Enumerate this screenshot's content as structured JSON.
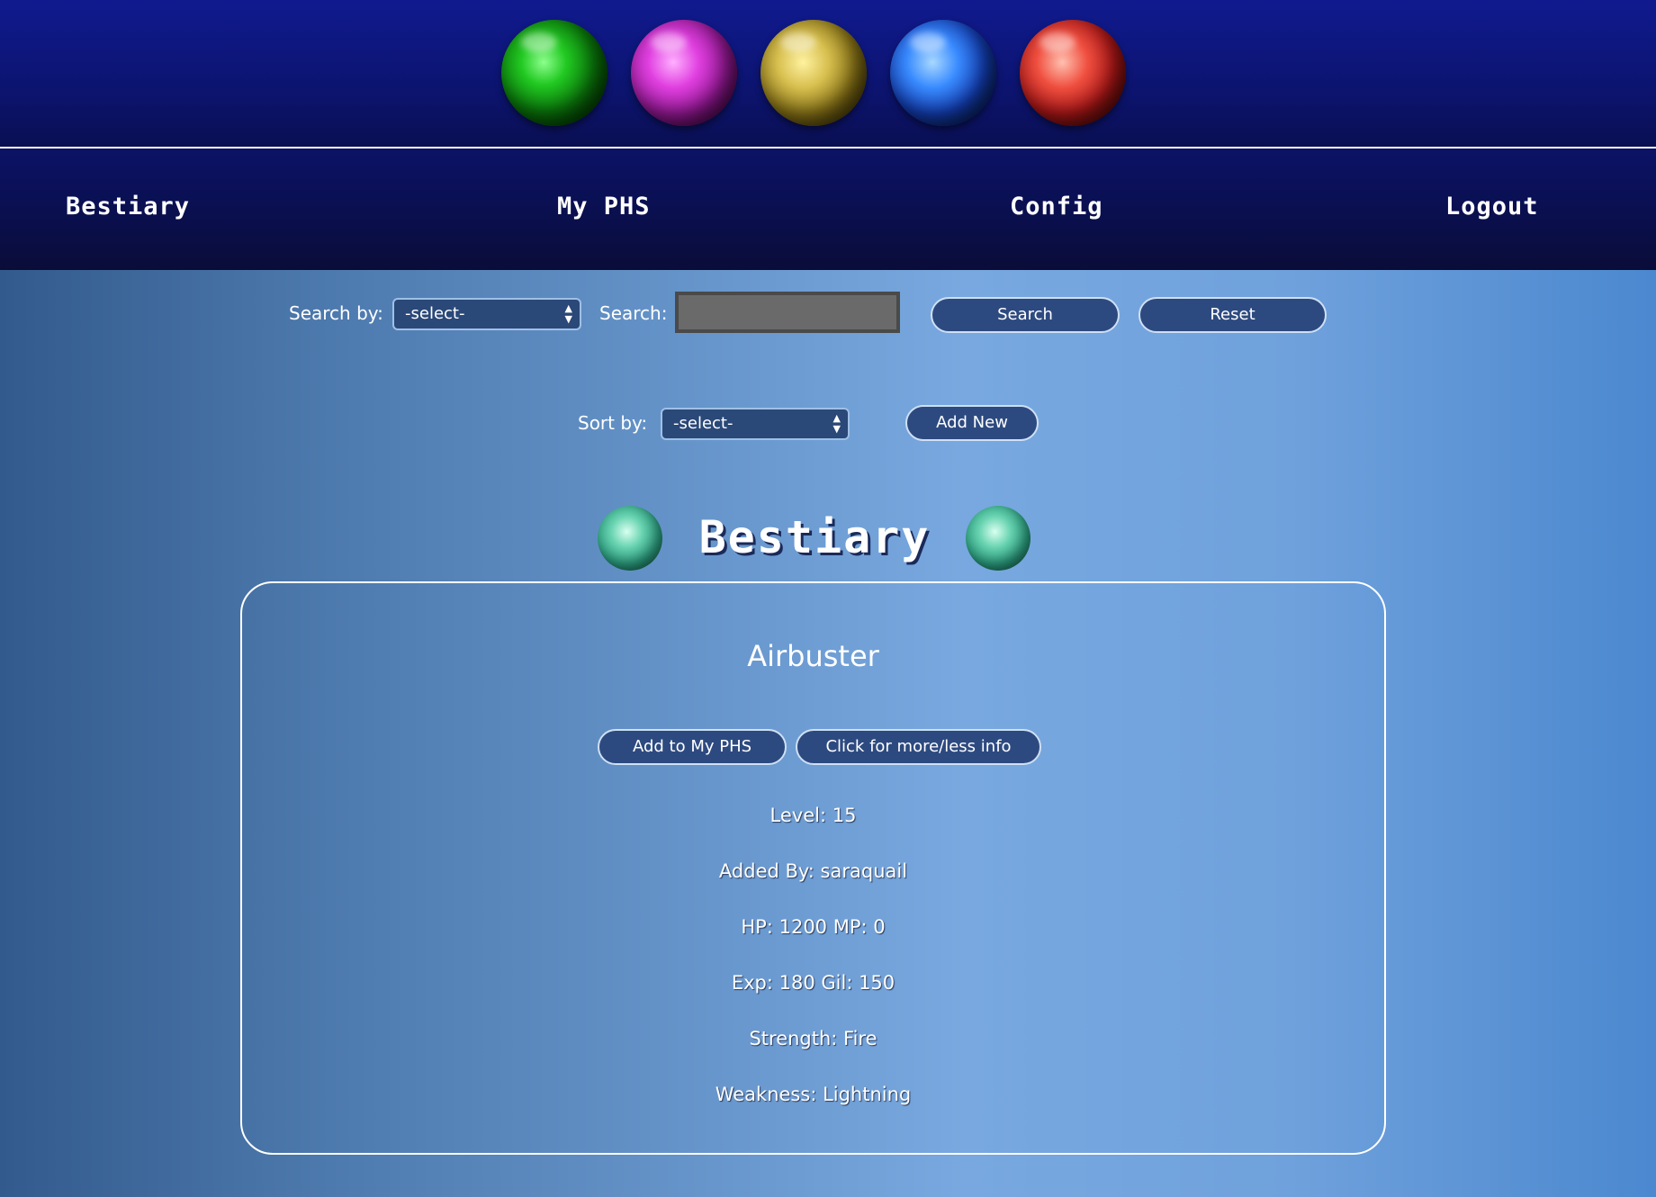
{
  "nav": {
    "bestiary": "Bestiary",
    "my_phs": "My PHS",
    "config": "Config",
    "logout": "Logout"
  },
  "search": {
    "search_by_label": "Search by:",
    "search_by_value": "-select-",
    "search_label": "Search:",
    "search_value": "",
    "search_button": "Search",
    "reset_button": "Reset"
  },
  "sort": {
    "sort_by_label": "Sort by:",
    "sort_by_value": "-select-",
    "add_new_button": "Add New"
  },
  "page_title": "Bestiary",
  "monster": {
    "name": "Airbuster",
    "add_button": "Add to My PHS",
    "info_button": "Click for more/less info",
    "level": "Level: 15",
    "added_by": "Added By: saraquail",
    "hp_mp": "HP: 1200 MP: 0",
    "exp_gil": "Exp: 180 Gil: 150",
    "strength": "Strength: Fire",
    "weakness": "Weakness: Lightning"
  },
  "colors": {
    "header_bg": "#101a8e",
    "button_bg": "#2d4a80",
    "orb_colors": [
      "green",
      "purple",
      "yellow",
      "blue",
      "red"
    ]
  }
}
